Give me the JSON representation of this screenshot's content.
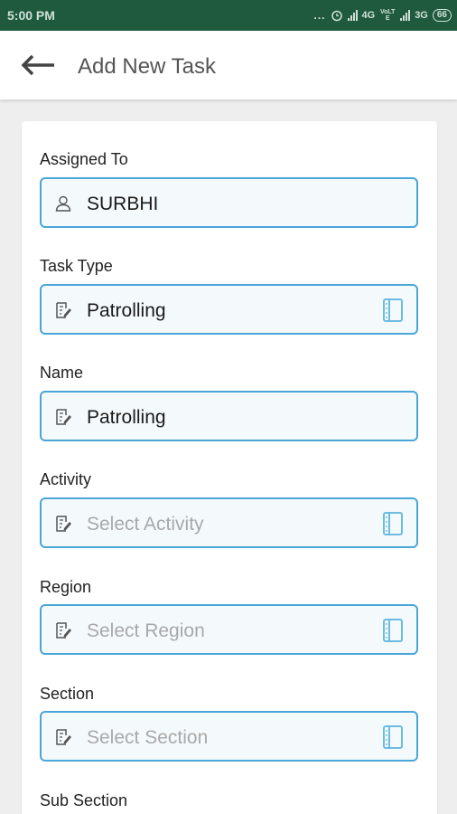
{
  "status_bar": {
    "time": "5:00 PM",
    "dots": "...",
    "network_1": "4G",
    "volte": "VoLTE",
    "network_2": "3G",
    "battery": "66"
  },
  "header": {
    "title": "Add New Task"
  },
  "form": {
    "assigned_to": {
      "label": "Assigned To",
      "value": "SURBHI"
    },
    "task_type": {
      "label": "Task Type",
      "value": "Patrolling"
    },
    "name": {
      "label": "Name",
      "value": "Patrolling"
    },
    "activity": {
      "label": "Activity",
      "placeholder": "Select Activity"
    },
    "region": {
      "label": "Region",
      "placeholder": "Select Region"
    },
    "section": {
      "label": "Section",
      "placeholder": "Select Section"
    },
    "sub_section": {
      "label": "Sub Section"
    }
  },
  "icons": {
    "user": "user-icon",
    "edit": "edit-note-icon",
    "picker": "book-picker-icon",
    "back": "back-arrow-icon"
  },
  "colors": {
    "status_bar": "#1f5a3f",
    "field_border": "#4aa6d8",
    "field_bg": "#f4fafc",
    "picker_icon": "#6bbbe2"
  }
}
